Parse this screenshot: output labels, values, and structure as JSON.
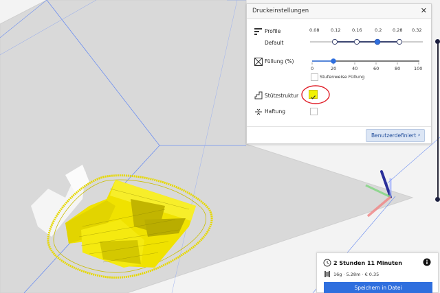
{
  "panel": {
    "title": "Druckeinstellungen",
    "close_icon": "close-icon",
    "profile": {
      "label": "Profile",
      "value": "Default",
      "ticks": [
        "0.08",
        "0.12",
        "0.16",
        "0.2",
        "0.28",
        "0.32"
      ],
      "selected": "0.2"
    },
    "infill": {
      "label": "Füllung (%)",
      "ticks": [
        "0",
        "20",
        "40",
        "60",
        "80",
        "100"
      ],
      "value": 20,
      "gradual_label": "Stufenweise Füllung",
      "gradual_checked": false
    },
    "support": {
      "label": "Stützstruktur",
      "checked": true,
      "highlight_color": "#f2f200",
      "annotation_color": "#e0202a"
    },
    "adhesion": {
      "label": "Haftung",
      "checked": false
    },
    "custom_button": "Benutzerdefiniert",
    "accent": "#2f6fde"
  },
  "job": {
    "time": "2 Stunden 11 Minuten",
    "details": "16g · 5.28m · € 0.35",
    "save_button": "Speichern in Datei",
    "info_icon": "info-icon",
    "clock_icon": "clock-icon",
    "spool_icon": "filament-spool-icon"
  }
}
